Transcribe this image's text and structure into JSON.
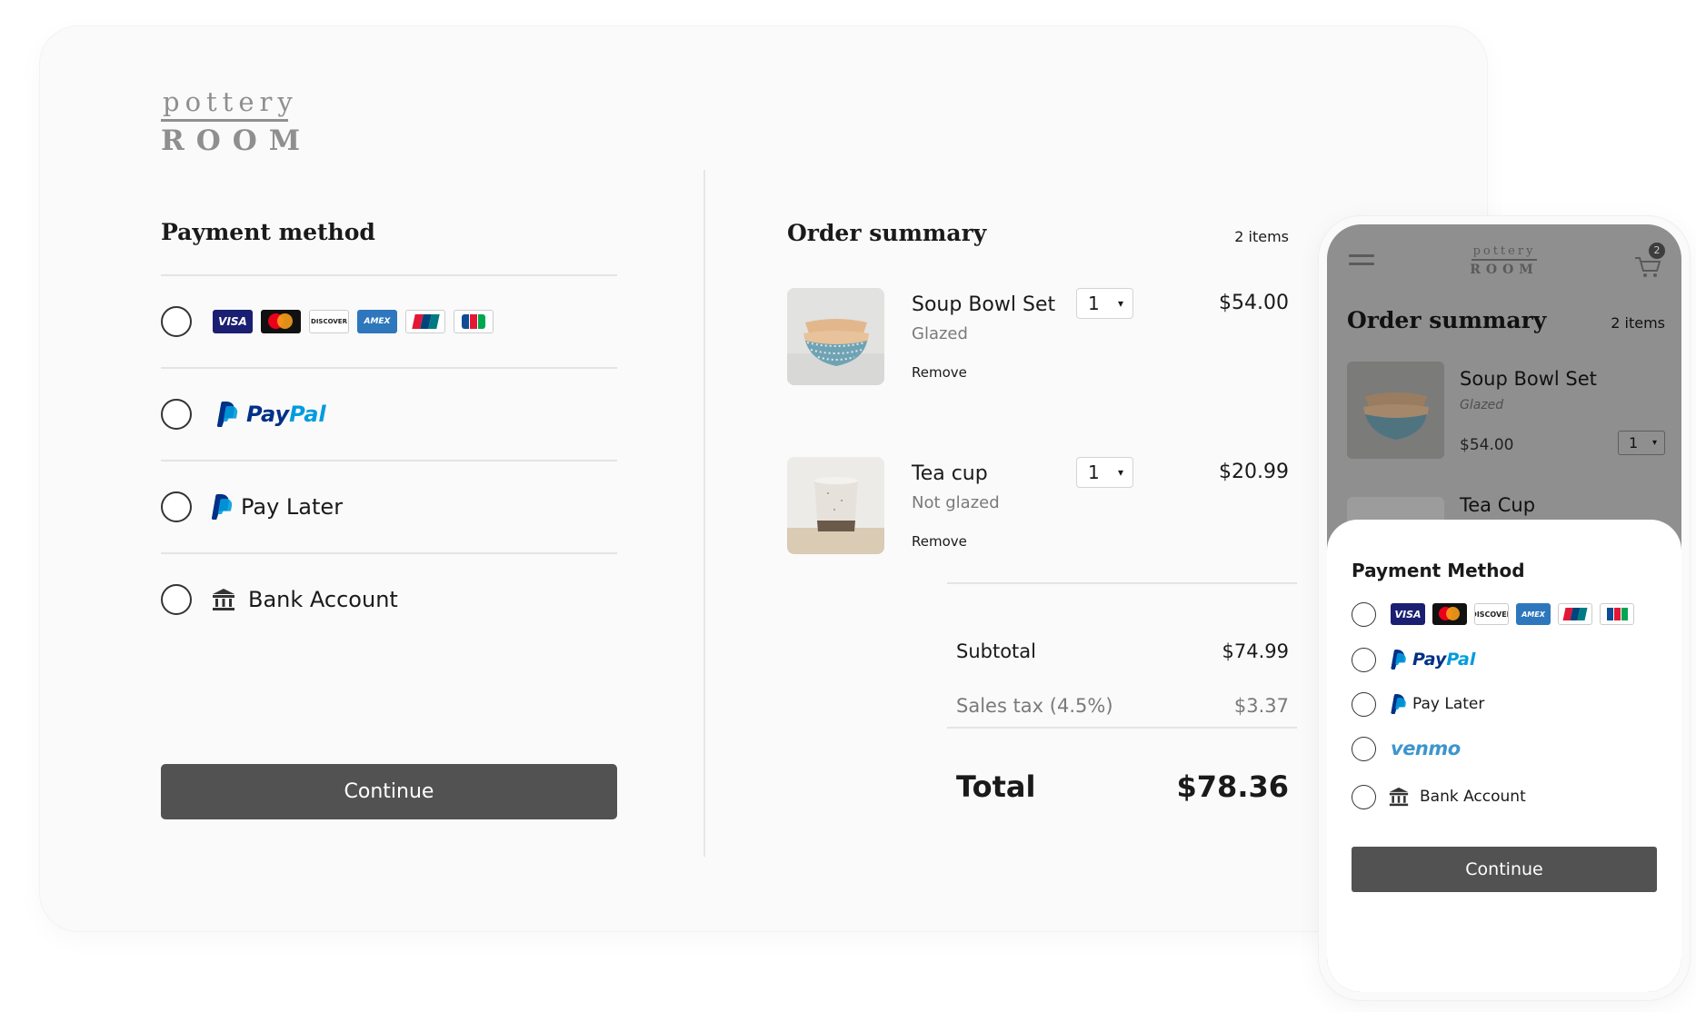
{
  "brand": {
    "line1": "pottery",
    "line2": "ROOM"
  },
  "payment": {
    "title": "Payment method",
    "cards": [
      "VISA",
      "mastercard",
      "DISCOVER",
      "AMEX",
      "UnionPay",
      "JCB"
    ],
    "paypal": {
      "pay": "Pay",
      "pal": "Pal"
    },
    "pay_later": "Pay Later",
    "bank": "Bank Account",
    "continue": "Continue"
  },
  "order": {
    "title": "Order summary",
    "count": "2 items",
    "items": [
      {
        "name": "Soup Bowl Set",
        "variant": "Glazed",
        "qty": "1",
        "price": "$54.00",
        "remove": "Remove"
      },
      {
        "name": "Tea cup",
        "variant": "Not glazed",
        "qty": "1",
        "price": "$20.99",
        "remove": "Remove"
      }
    ],
    "subtotal_label": "Subtotal",
    "subtotal": "$74.99",
    "tax_label": "Sales tax (4.5%)",
    "tax": "$3.37",
    "total_label": "Total",
    "total": "$78.36"
  },
  "mobile": {
    "cart_count": "2",
    "order_title": "Order summary",
    "count": "2 items",
    "item1": {
      "name": "Soup Bowl Set",
      "variant": "Glazed",
      "price": "$54.00",
      "qty": "1"
    },
    "item2": {
      "name": "Tea Cup"
    },
    "payment_title": "Payment Method",
    "paypal": {
      "pay": "Pay",
      "pal": "Pal"
    },
    "pay_later": "Pay Later",
    "venmo": "venmo",
    "bank": "Bank Account",
    "continue": "Continue"
  },
  "icons": {
    "menu": "hamburger-icon",
    "cart": "cart-icon",
    "bank": "bank-icon",
    "paypal": "paypal-icon"
  },
  "colors": {
    "button": "#525252",
    "paypal_dark": "#003087",
    "paypal_light": "#009cde",
    "venmo": "#3d95ce",
    "visa": "#1a1f71",
    "amex": "#2e77bc"
  }
}
